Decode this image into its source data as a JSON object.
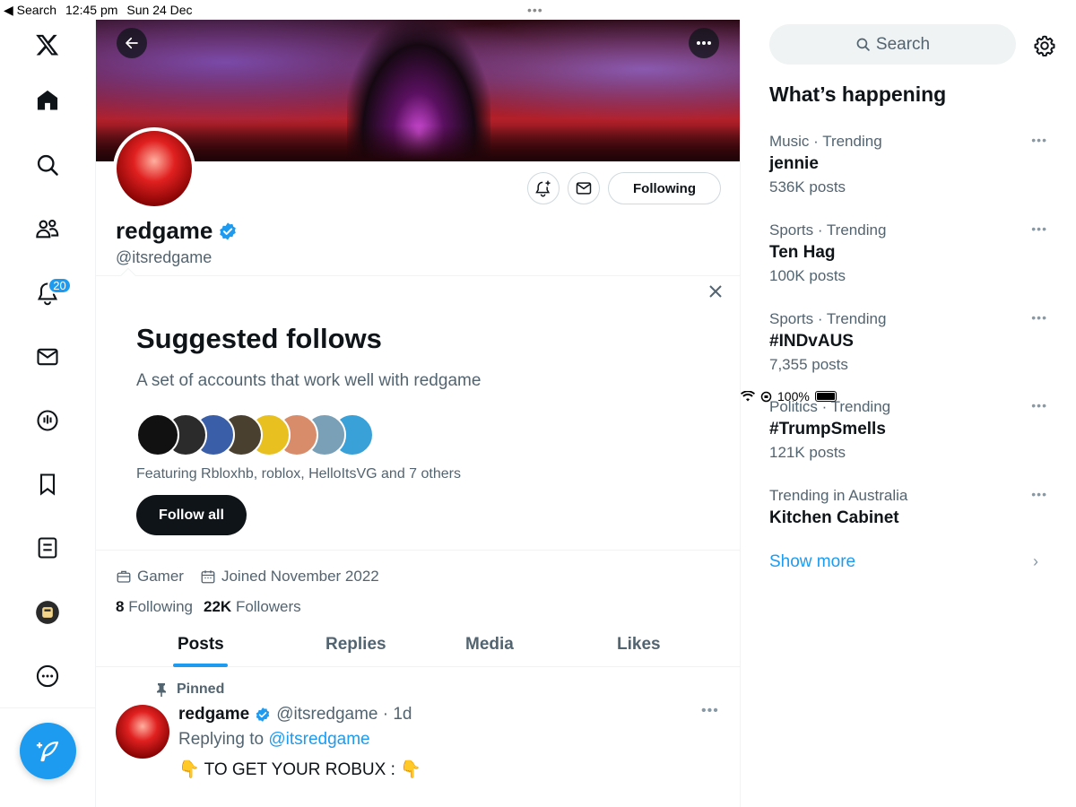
{
  "status_bar": {
    "back_label": "◀ Search",
    "time": "12:45 pm",
    "date": "Sun 24 Dec",
    "battery": "100%"
  },
  "nav": {
    "notifications_badge": "20"
  },
  "profile": {
    "name": "redgame",
    "handle": "@itsredgame",
    "following_button": "Following",
    "category": "Gamer",
    "joined": "Joined November 2022",
    "following_count": "8",
    "following_label": "Following",
    "followers_count": "22K",
    "followers_label": "Followers"
  },
  "suggested": {
    "title": "Suggested follows",
    "subtitle": "A set of accounts that work well with redgame",
    "featuring": "Featuring Rbloxhb, roblox, HelloItsVG and 7 others",
    "follow_all": "Follow all",
    "avatar_colors": [
      "#111111",
      "#2b2b2b",
      "#3a5ea8",
      "#4a4030",
      "#e8c020",
      "#d98c6a",
      "#7aa0b8",
      "#3aa0d8"
    ]
  },
  "tabs": [
    "Posts",
    "Replies",
    "Media",
    "Likes"
  ],
  "tweet": {
    "pinned_label": "Pinned",
    "name": "redgame",
    "handle_time": "@itsredgame · 1d",
    "replying_prefix": "Replying to",
    "replying_handle": "@itsredgame",
    "text": "👇 TO GET YOUR ROBUX : 👇"
  },
  "sidebar": {
    "search_placeholder": "Search",
    "title": "What’s happening",
    "trends": [
      {
        "context": "Music · Trending",
        "topic": "jennie",
        "count": "536K posts"
      },
      {
        "context": "Sports · Trending",
        "topic": "Ten Hag",
        "count": "100K posts"
      },
      {
        "context": "Sports · Trending",
        "topic": "#INDvAUS",
        "count": "7,355 posts"
      },
      {
        "context": "Politics · Trending",
        "topic": "#TrumpSmells",
        "count": "121K posts"
      },
      {
        "context": "Trending in Australia",
        "topic": "Kitchen Cabinet",
        "count": ""
      }
    ],
    "show_more": "Show more"
  },
  "colors": {
    "accent": "#1d9bf0",
    "text": "#0f1419",
    "secondary": "#536471"
  }
}
